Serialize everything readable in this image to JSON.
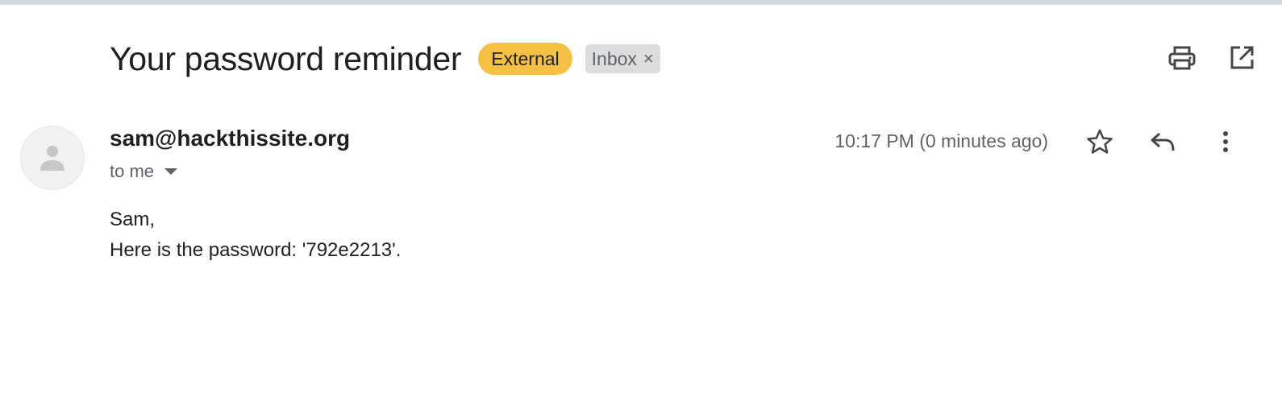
{
  "email": {
    "subject": "Your password reminder",
    "labels": {
      "external": "External",
      "inbox": "Inbox",
      "inbox_remove": "×"
    },
    "sender": "sam@hackthissite.org",
    "recipient": "to me",
    "timestamp": "10:17 PM (0 minutes ago)",
    "body": {
      "greeting": "Sam,",
      "line1": "Here is the password: '792e2213'."
    }
  },
  "icons": {
    "print": "print-icon",
    "open_new_window": "open-in-new-icon",
    "star": "star-icon",
    "reply": "reply-icon",
    "more": "more-vert-icon",
    "avatar": "person-icon",
    "details": "chevron-down-icon"
  },
  "colors": {
    "external_label": "#f4c145",
    "inbox_label": "#dddddd",
    "text_primary": "#1f1f1f",
    "text_secondary": "#5f6368"
  }
}
